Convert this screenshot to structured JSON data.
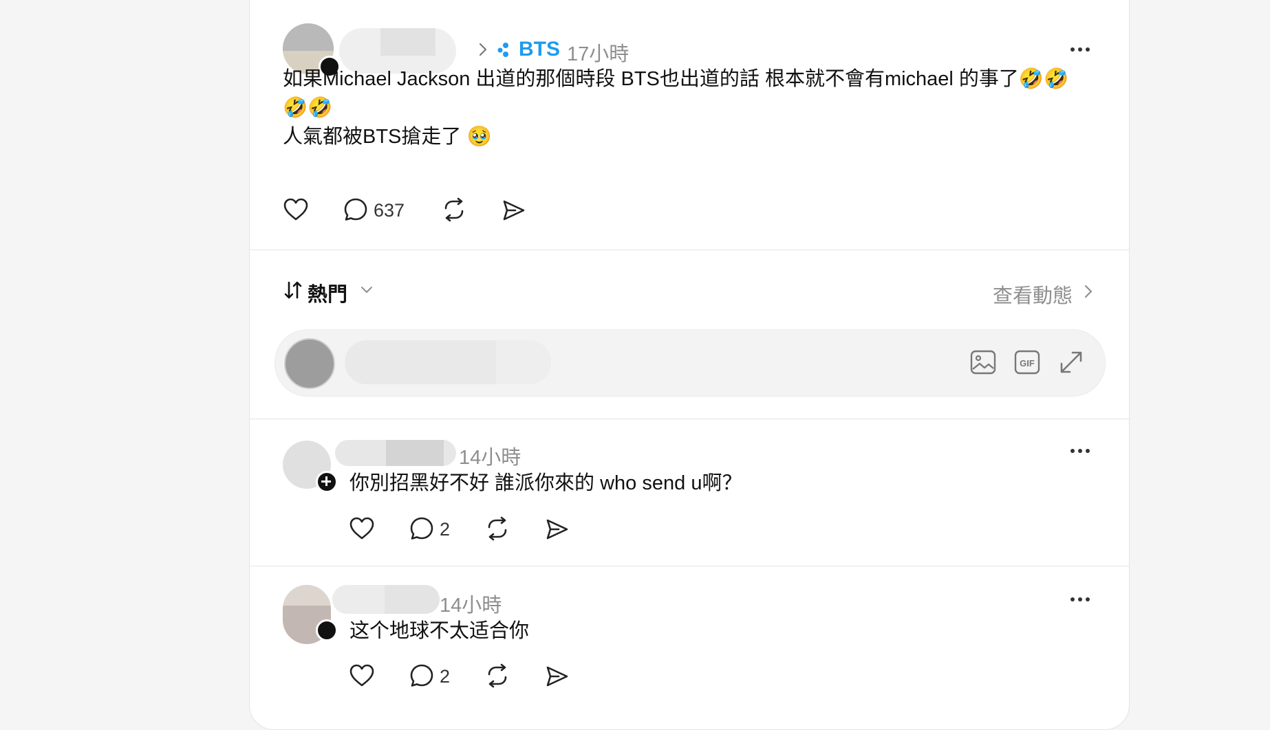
{
  "post": {
    "community_name": "BTS",
    "timestamp": "17小時",
    "text_line1": "如果Michael Jackson 出道的那個時段 BTS也出道的話 根本就不會有michael 的事了🤣🤣",
    "text_line2": "🤣🤣",
    "text_line3": "人氣都被BTS搶走了 🥹",
    "reply_count": "637"
  },
  "sort": {
    "label": "熱門",
    "view_activity": "查看動態"
  },
  "comments": [
    {
      "timestamp": "14小時",
      "text": "你別招黑好不好 誰派你來的 who send u啊？",
      "reply_count": "2"
    },
    {
      "timestamp": "14小時",
      "text": "这个地球不太适合你",
      "reply_count": "2"
    }
  ],
  "icons": [
    "heart-icon",
    "comment-icon",
    "repost-icon",
    "share-icon",
    "more-icon",
    "image-icon",
    "gif-icon",
    "expand-icon",
    "sort-icon",
    "chevron-down-icon",
    "chevron-right-icon",
    "community-icon"
  ],
  "colors": {
    "accent": "#1d9bf0",
    "muted": "#8e8e8e",
    "divider": "#e3e3e3"
  }
}
